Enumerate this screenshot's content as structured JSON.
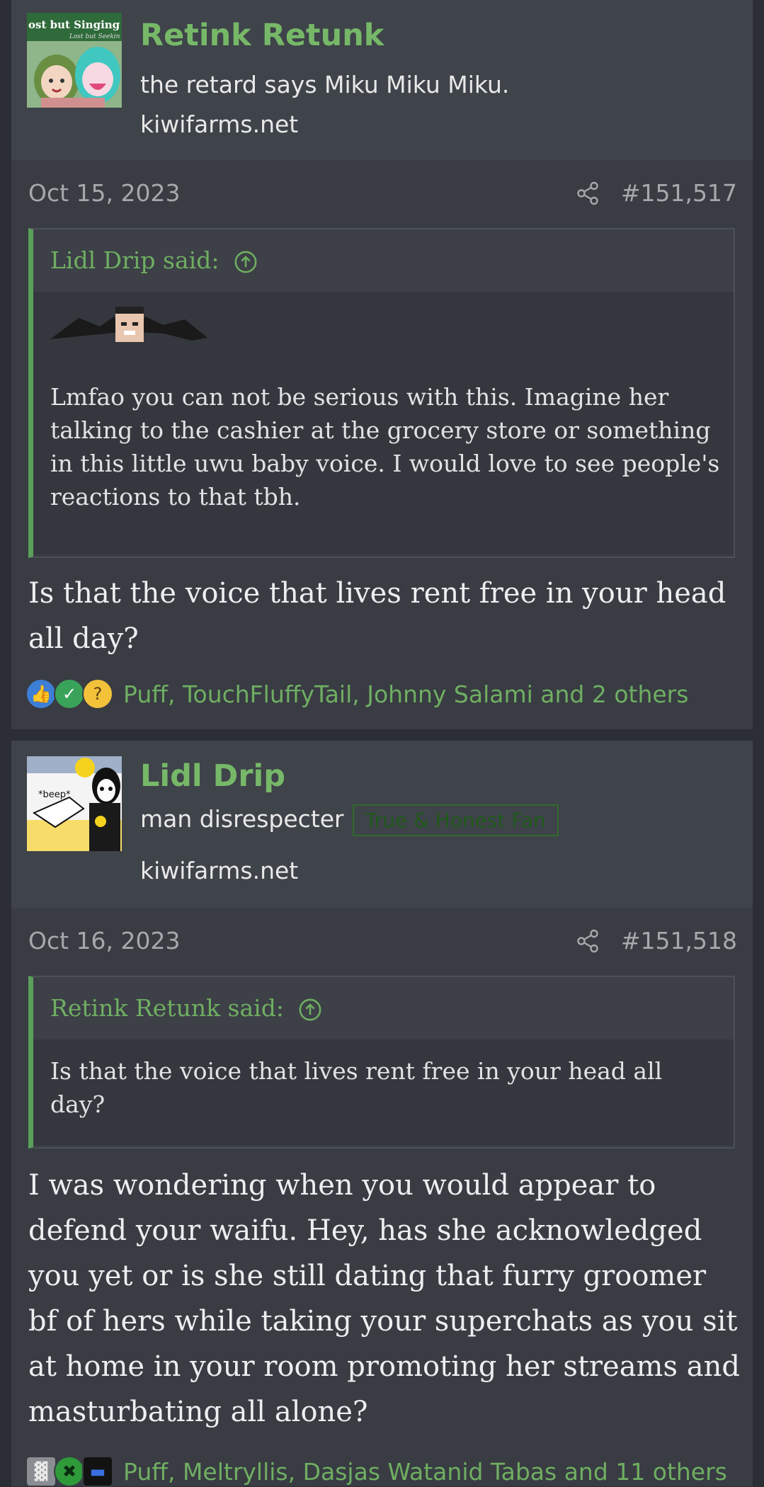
{
  "posts": [
    {
      "username": "Retink Retunk",
      "user_title": "the retard says Miku Miku Miku.",
      "site": "kiwifarms.net",
      "avatar_text_1": "ost but Singing",
      "avatar_text_2": "Lost but Seekin",
      "date": "Oct 15, 2023",
      "post_number": "#151,517",
      "quote_author": "Lidl Drip said:",
      "quote_text": "Lmfao you can not be serious with this. Imagine her talking to the cashier at the grocery store or something in this little uwu baby voice. I would love to see people's reactions to that tbh.",
      "message": "Is that the voice that lives rent free in your head all day?",
      "reaction_icons": [
        "like-icon",
        "agree-icon",
        "thinking-icon"
      ],
      "reactions_text": "Puff, TouchFluffyTail, Johnny Salami and 2 others"
    },
    {
      "username": "Lidl Drip",
      "user_title": "man disrespecter",
      "banner": "True & Honest Fan",
      "site": "kiwifarms.net",
      "avatar_text_1": "*beep*",
      "date": "Oct 16, 2023",
      "post_number": "#151,518",
      "quote_author": "Retink Retunk said:",
      "quote_text": "Is that the voice that lives rent free in your head all day?",
      "message": "I was wondering when you would appear to defend your waifu. Hey, has she acknowledged you yet or is she still dating that furry groomer bf of hers while taking your superchats as you sit at home in your room promoting her streams and masturbating all alone?",
      "reaction_icons": [
        "trash-icon",
        "x-icon",
        "top-hat-icon"
      ],
      "reactions_text": "Puff, Meltryllis, Dasjas Watanid Tabas and 11 others"
    }
  ],
  "colors": {
    "accent_green": "#76b868",
    "quote_border": "#5aa05a",
    "background": "#2b2e34",
    "post_bg": "#393c43"
  }
}
